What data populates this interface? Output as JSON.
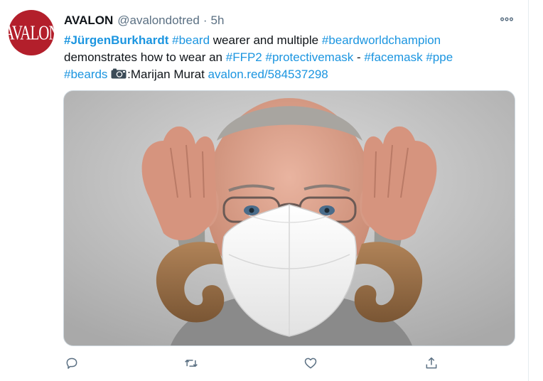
{
  "tweet": {
    "avatar_text": "AVALON",
    "display_name": "AVALON",
    "handle": "@avalondotred",
    "separator": "·",
    "time": "5h",
    "line1": {
      "tag_burkhardt": "#JürgenBurkhardt",
      "tag_beard": "#beard",
      "text_a": " wearer and multiple ",
      "tag_champion": "#beardworldchampion"
    },
    "line2": {
      "text_b": "demonstrates how to wear an ",
      "tag_ffp2": "#FFP2",
      "tag_protective": "#protectivemask",
      "text_dash": " - ",
      "tag_facemask": "#facemask",
      "tag_ppe": "#ppe"
    },
    "line3": {
      "tag_beards": "#beards",
      "photo_credit": ":Marijan Murat",
      "link": "avalon.red/584537298"
    }
  },
  "icons": {
    "more": "more-horizontal-icon",
    "reply": "reply-icon",
    "retweet": "retweet-icon",
    "like": "heart-icon",
    "share": "share-icon",
    "camera": "camera-icon"
  },
  "colors": {
    "link": "#1b95e0",
    "secondary_text": "#5b7083",
    "avatar_bg": "#b31f2b"
  }
}
